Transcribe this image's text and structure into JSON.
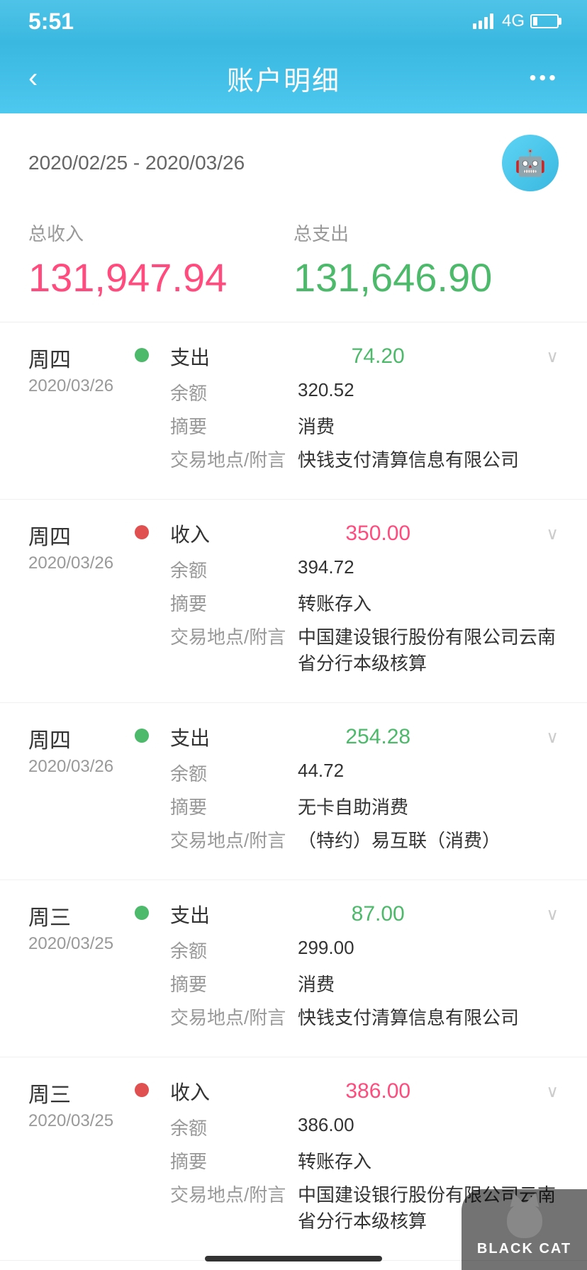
{
  "statusBar": {
    "time": "5:51",
    "signal": "4G"
  },
  "header": {
    "title": "账户明细",
    "backLabel": "‹",
    "moreLabel": "•••"
  },
  "dateRange": {
    "text": "2020/02/25 - 2020/03/26"
  },
  "summary": {
    "incomeLabel": "总收入",
    "expenseLabel": "总支出",
    "incomeAmount": "131,947.94",
    "expenseAmount": "131,646.90"
  },
  "transactions": [
    {
      "dayLabel": "周四",
      "dateLabel": "2020/03/26",
      "dotType": "green",
      "type": "支出",
      "amount": "74.20",
      "amountType": "green",
      "balance": "320.52",
      "summary": "消费",
      "location": "快钱支付清算信息有限公司"
    },
    {
      "dayLabel": "周四",
      "dateLabel": "2020/03/26",
      "dotType": "red",
      "type": "收入",
      "amount": "350.00",
      "amountType": "red",
      "balance": "394.72",
      "summary": "转账存入",
      "location": "中国建设银行股份有限公司云南省分行本级核算"
    },
    {
      "dayLabel": "周四",
      "dateLabel": "2020/03/26",
      "dotType": "green",
      "type": "支出",
      "amount": "254.28",
      "amountType": "green",
      "balance": "44.72",
      "summary": "无卡自助消费",
      "location": "（特约）易互联（消费）"
    },
    {
      "dayLabel": "周三",
      "dateLabel": "2020/03/25",
      "dotType": "green",
      "type": "支出",
      "amount": "87.00",
      "amountType": "green",
      "balance": "299.00",
      "summary": "消费",
      "location": "快钱支付清算信息有限公司"
    },
    {
      "dayLabel": "周三",
      "dateLabel": "2020/03/25",
      "dotType": "red",
      "type": "收入",
      "amount": "386.00",
      "amountType": "red",
      "balance": "386.00",
      "summary": "转账存入",
      "location": "中国建设银行股份有限公司云南省分行本级核算"
    }
  ],
  "watermark": {
    "text": "BLACK CAT"
  },
  "labels": {
    "balance": "余额",
    "summary": "摘要",
    "location": "交易地点/附言"
  }
}
